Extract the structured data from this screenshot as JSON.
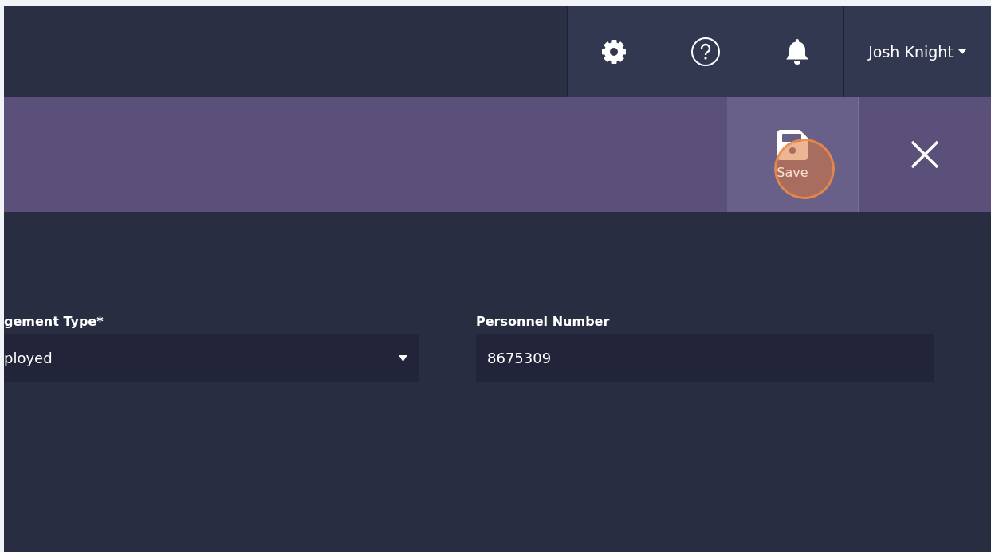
{
  "header": {
    "user_menu": {
      "label": "Josh Knight"
    }
  },
  "toolbar": {
    "save_button": {
      "label": "Save"
    }
  },
  "form": {
    "fields": [
      {
        "kind": "select",
        "label": "gement Type*",
        "value": "ployed"
      },
      {
        "kind": "text",
        "label": "Personnel Number",
        "value": "8675309"
      }
    ]
  }
}
